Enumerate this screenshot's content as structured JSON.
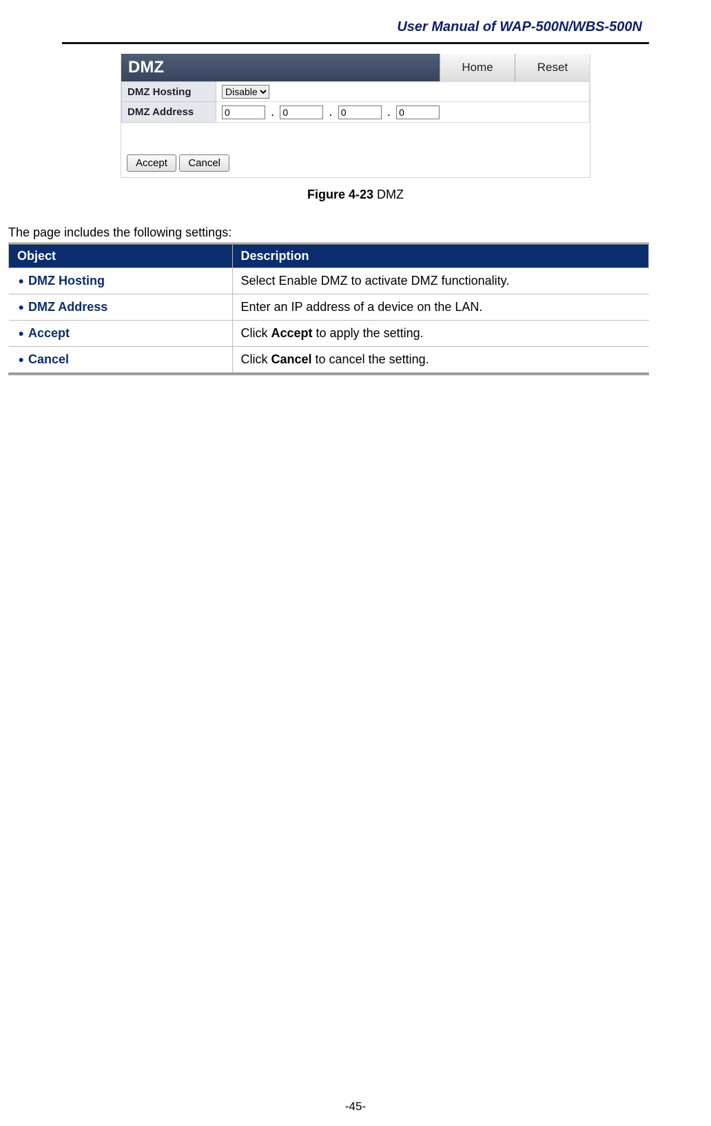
{
  "header": {
    "title": "User Manual of WAP-500N/WBS-500N"
  },
  "screenshot": {
    "panel_title": "DMZ",
    "tabs": {
      "home": "Home",
      "reset": "Reset"
    },
    "rows": {
      "hosting_label": "DMZ Hosting",
      "hosting_value": "Disable",
      "address_label": "DMZ Address",
      "octet1": "0",
      "octet2": "0",
      "octet3": "0",
      "octet4": "0"
    },
    "buttons": {
      "accept": "Accept",
      "cancel": "Cancel"
    }
  },
  "caption": {
    "prefix": "Figure 4-23",
    "suffix": " DMZ"
  },
  "intro": "The page includes the following settings:",
  "table": {
    "headers": {
      "object": "Object",
      "description": "Description"
    },
    "rows": [
      {
        "object": "DMZ Hosting",
        "desc_plain": "Select Enable DMZ to activate DMZ functionality."
      },
      {
        "object": "DMZ Address",
        "desc_plain": "Enter an IP address of a device on the LAN."
      },
      {
        "object": "Accept",
        "desc_pre": "Click ",
        "desc_bold": "Accept",
        "desc_post": " to apply the setting."
      },
      {
        "object": "Cancel",
        "desc_pre": "Click ",
        "desc_bold": "Cancel",
        "desc_post": " to cancel the setting."
      }
    ]
  },
  "page_number": "-45-"
}
